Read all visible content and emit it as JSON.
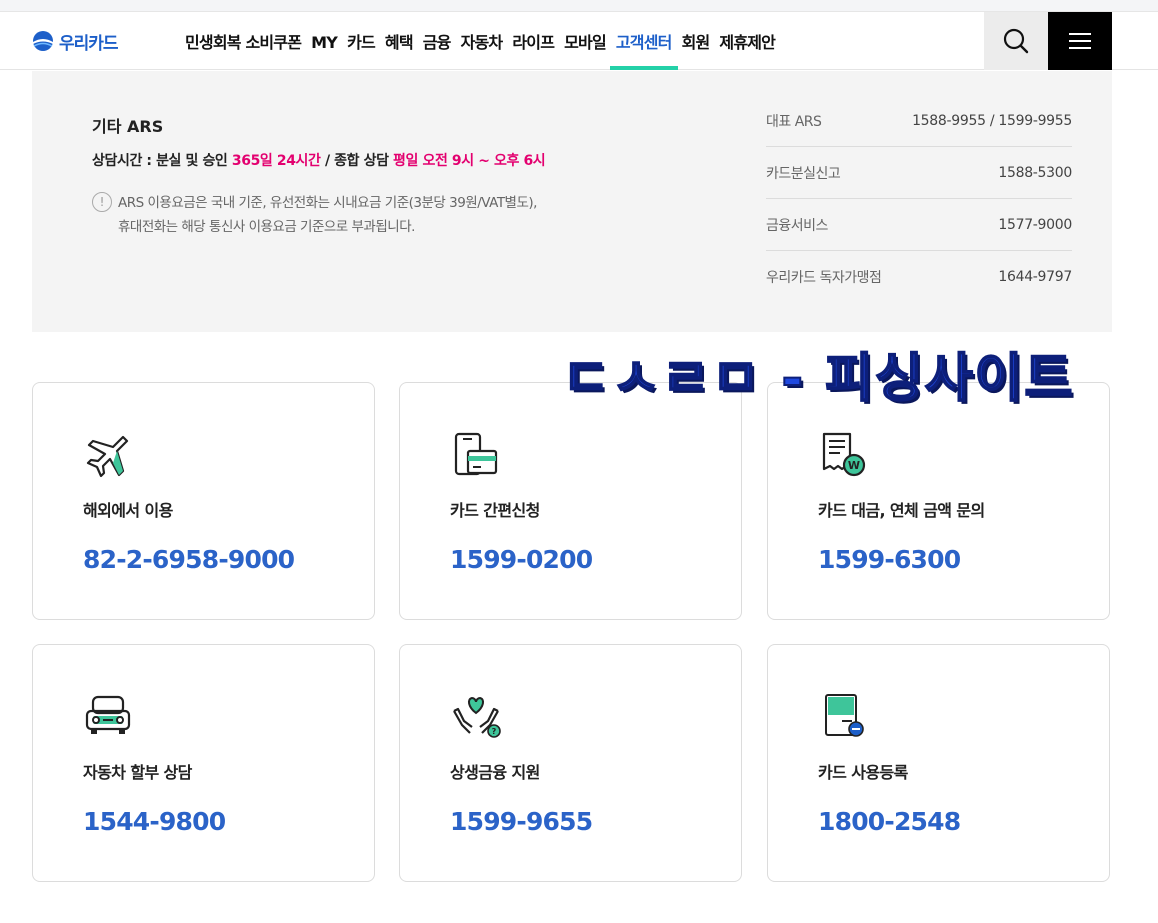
{
  "brand": {
    "logo_text": "우리카드"
  },
  "nav": {
    "items": [
      {
        "label": "민생회복 소비쿠폰"
      },
      {
        "label": "MY"
      },
      {
        "label": "카드"
      },
      {
        "label": "혜택"
      },
      {
        "label": "금융"
      },
      {
        "label": "자동차"
      },
      {
        "label": "라이프"
      },
      {
        "label": "모바일"
      },
      {
        "label": "고객센터"
      },
      {
        "label": "회원"
      },
      {
        "label": "제휴제안"
      }
    ],
    "active": "고객센터"
  },
  "ars": {
    "title": "기타 ARS",
    "hours_prefix": "상담시간 : 분실 및 승인 ",
    "hours_highlight1": "365일 24시간",
    "hours_mid": " / 종합 상담 ",
    "hours_highlight2": "평일 오전 9시 ~ 오후 6시",
    "notice_line1": "ARS 이용요금은 국내 기준, 유선전화는 시내요금 기준(3분당 39원/VAT별도),",
    "notice_line2": "휴대전화는 해당 통신사 이용요금 기준으로 부과됩니다.",
    "list": [
      {
        "label": "대표 ARS",
        "number": "1588-9955 / 1599-9955"
      },
      {
        "label": "카드분실신고",
        "number": "1588-5300"
      },
      {
        "label": "금융서비스",
        "number": "1577-9000"
      },
      {
        "label": "우리카드 독자가맹점",
        "number": "1644-9797"
      }
    ]
  },
  "overlay_text": "ㄷㅅㄹㅁ - 피싱사이트",
  "cards": [
    {
      "title": "해외에서 이용",
      "phone": "82-2-6958-9000",
      "icon": "airplane-icon"
    },
    {
      "title": "카드 간편신청",
      "phone": "1599-0200",
      "icon": "phone-card-icon"
    },
    {
      "title": "카드 대금, 연체 금액 문의",
      "phone": "1599-6300",
      "icon": "receipt-won-icon"
    },
    {
      "title": "자동차 할부 상담",
      "phone": "1544-9800",
      "icon": "car-icon"
    },
    {
      "title": "상생금융 지원",
      "phone": "1599-9655",
      "icon": "hands-heart-icon"
    },
    {
      "title": "카드 사용등록",
      "phone": "1800-2548",
      "icon": "card-register-icon"
    }
  ],
  "colors": {
    "brand_blue": "#1d5fc9",
    "accent_green": "#24d1a8",
    "highlight_pink": "#e3006f",
    "phone_blue": "#2b63c8"
  }
}
